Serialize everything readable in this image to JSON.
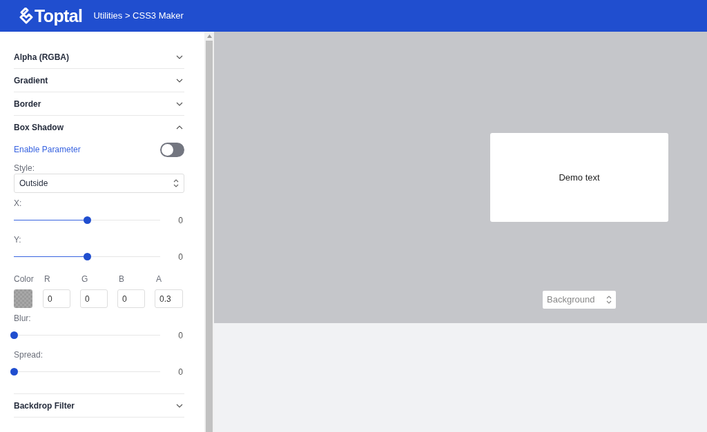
{
  "header": {
    "logo": "Toptal",
    "breadcrumb": "Utilities > CSS3 Maker"
  },
  "sections": [
    {
      "title": "Alpha (RGBA)",
      "expanded": false
    },
    {
      "title": "Gradient",
      "expanded": false
    },
    {
      "title": "Border",
      "expanded": false
    },
    {
      "title": "Box Shadow",
      "expanded": true,
      "controls": [
        {
          "kind": "toggle",
          "label": "Enable Parameter",
          "on": false
        },
        {
          "kind": "select",
          "label": "Style:",
          "value": "Outside"
        },
        {
          "kind": "slider",
          "label": "X:",
          "level": 0.5,
          "reading": "0"
        },
        {
          "kind": "slider",
          "label": "Y:",
          "level": 0.5,
          "reading": "0"
        },
        {
          "kind": "color",
          "label": "Color",
          "channels": [
            {
              "label": "R",
              "value": "0"
            },
            {
              "label": "G",
              "value": "0"
            },
            {
              "label": "B",
              "value": "0"
            },
            {
              "label": "A",
              "value": "0.3"
            }
          ]
        },
        {
          "kind": "slider",
          "label": "Blur:",
          "level": 0,
          "reading": "0"
        },
        {
          "kind": "slider",
          "label": "Spread:",
          "level": 0,
          "reading": "0"
        }
      ]
    },
    {
      "title": "Backdrop Filter",
      "expanded": false
    }
  ],
  "preview": {
    "demo_text": "Demo text",
    "background_select": "Background"
  }
}
